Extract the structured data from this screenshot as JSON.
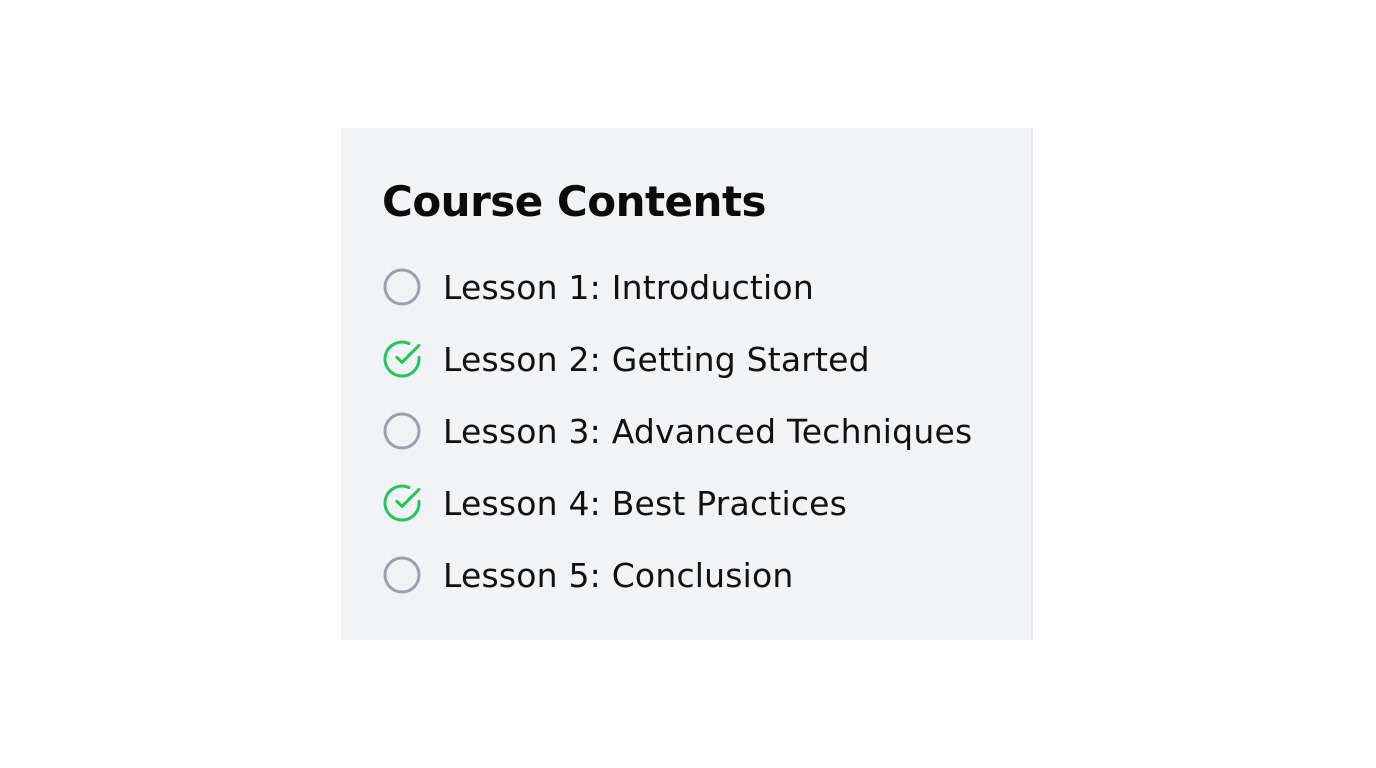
{
  "course": {
    "title": "Course Contents",
    "lessons": [
      {
        "label": "Lesson 1: Introduction",
        "completed": false,
        "icon": "circle-icon"
      },
      {
        "label": "Lesson 2: Getting Started",
        "completed": true,
        "icon": "check-circle-icon"
      },
      {
        "label": "Lesson 3: Advanced Techniques",
        "completed": false,
        "icon": "circle-icon"
      },
      {
        "label": "Lesson 4: Best Practices",
        "completed": true,
        "icon": "check-circle-icon"
      },
      {
        "label": "Lesson 5: Conclusion",
        "completed": false,
        "icon": "circle-icon"
      }
    ]
  },
  "colors": {
    "panel_background": "#f2f3f5",
    "incomplete_icon": "#9aa1ac",
    "complete_icon": "#22c55e",
    "text": "#111111"
  }
}
